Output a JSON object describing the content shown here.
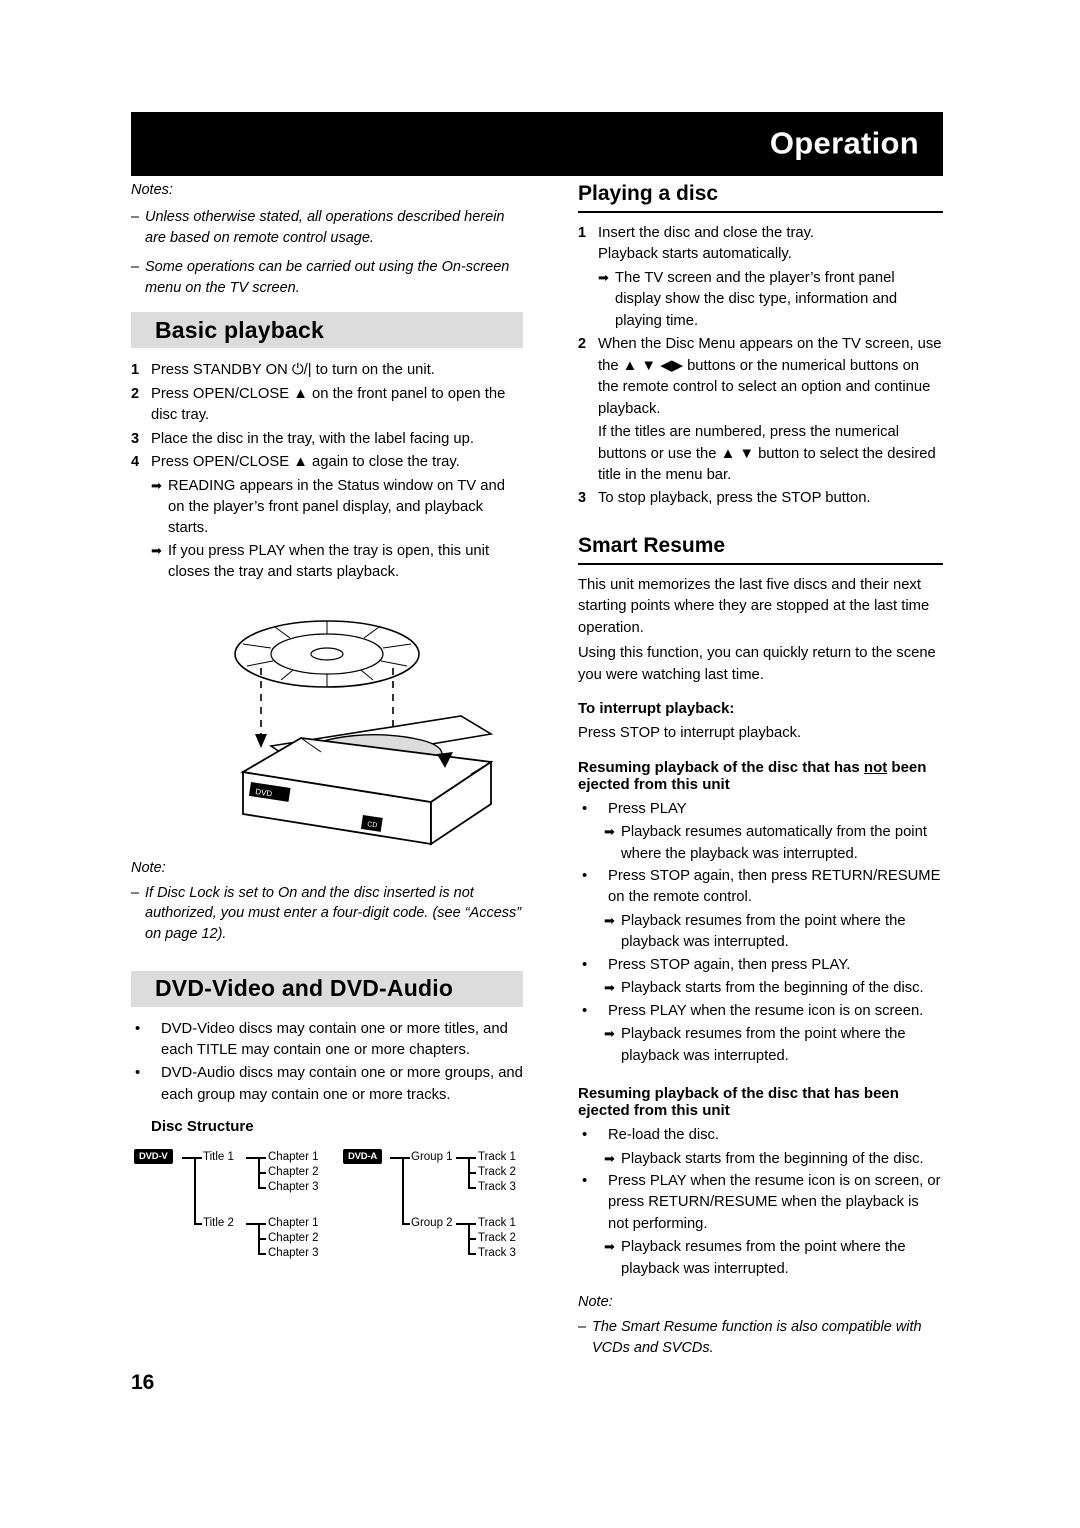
{
  "header": {
    "title": "Operation"
  },
  "page_number": "16",
  "left": {
    "notes_label": "Notes:",
    "notes": [
      "Unless otherwise stated, all operations described herein are based on remote control usage.",
      "Some operations can be carried out using the On-screen menu on the TV screen."
    ],
    "basic_playback": {
      "heading": "Basic playback",
      "steps": [
        {
          "num": "1",
          "text": "Press STANDBY ON ⏻/| to turn on the unit."
        },
        {
          "num": "2",
          "text": "Press OPEN/CLOSE ▲ on the front panel to open the disc tray."
        },
        {
          "num": "3",
          "text": "Place the disc in the tray, with the label facing up."
        },
        {
          "num": "4",
          "text": "Press OPEN/CLOSE ▲ again to close the tray."
        }
      ],
      "arrows": [
        "READING appears in the Status window on TV and on the player’s front panel display, and playback starts.",
        "If you press PLAY when the tray is open, this unit closes the tray and starts playback."
      ]
    },
    "note": {
      "label": "Note:",
      "text": "If Disc Lock is set to On and the disc inserted is not authorized, you must enter a four-digit code. (see “Access” on page 12)."
    },
    "dvd_section": {
      "heading": "DVD-Video and DVD-Audio",
      "bullets": [
        "DVD-Video discs may contain one or more titles, and each TITLE may contain one or more chapters.",
        "DVD-Audio discs may contain one or more groups, and each group may contain one or more tracks."
      ],
      "disc_structure_label": "Disc Structure",
      "diagram": {
        "video_badge": "DVD-V",
        "audio_badge": "DVD-A",
        "video_nodes": [
          {
            "title": "Title 1",
            "children": [
              "Chapter 1",
              "Chapter 2",
              "Chapter 3"
            ]
          },
          {
            "title": "Title 2",
            "children": [
              "Chapter 1",
              "Chapter 2",
              "Chapter 3"
            ]
          }
        ],
        "audio_nodes": [
          {
            "title": "Group 1",
            "children": [
              "Track 1",
              "Track 2",
              "Track 3"
            ]
          },
          {
            "title": "Group 2",
            "children": [
              "Track 1",
              "Track 2",
              "Track 3"
            ]
          }
        ],
        "tray_label": "DVD",
        "disc_center_label": "CD"
      }
    }
  },
  "right": {
    "playing_a_disc": {
      "heading": "Playing a disc",
      "steps": [
        {
          "num": "1",
          "lines": [
            "Insert the disc and close the tray.",
            "Playback starts automatically."
          ],
          "arrows": [
            "The TV screen and the player’s front panel display show the disc type, information and playing time."
          ]
        },
        {
          "num": "2",
          "lines": [
            "When the Disc Menu appears on the TV screen, use the ▲ ▼ ◀▶ buttons or the numerical buttons on the remote control to select an option and continue playback.",
            "If the titles are numbered, press the numerical buttons or use the ▲ ▼ button to select the desired title in the menu bar."
          ],
          "arrows": []
        },
        {
          "num": "3",
          "lines": [
            "To stop playback, press the STOP button."
          ],
          "arrows": []
        }
      ]
    },
    "smart_resume": {
      "heading": "Smart Resume",
      "paragraphs": [
        "This unit memorizes the last five discs and their next starting points where they are stopped at the last time operation.",
        "Using this function, you can quickly return to the scene you were watching last time."
      ],
      "interrupt": {
        "heading": "To interrupt playback:",
        "text": "Press STOP to interrupt playback."
      },
      "not_ejected": {
        "heading_pre": "Resuming playback of the disc that has ",
        "heading_underline": "not",
        "heading_post": " been ejected from this unit",
        "items": [
          {
            "bullet": "Press PLAY",
            "arrows": [
              "Playback resumes automatically from the point where the playback was interrupted."
            ]
          },
          {
            "bullet": "Press STOP again, then press RETURN/RESUME on the remote control.",
            "arrows": [
              "Playback resumes from the point where the playback was interrupted."
            ]
          },
          {
            "bullet": "Press STOP again, then press PLAY.",
            "arrows": [
              "Playback starts from the beginning of the disc."
            ]
          },
          {
            "bullet": "Press PLAY when the resume icon is on screen.",
            "arrows": [
              "Playback resumes from the point where the playback was interrupted."
            ]
          }
        ]
      },
      "ejected": {
        "heading": "Resuming playback of the disc that has been ejected from this unit",
        "items": [
          {
            "bullet": "Re-load the disc.",
            "arrows": [
              "Playback starts from the beginning of the disc."
            ]
          },
          {
            "bullet": "Press PLAY when the resume icon is on screen, or press RETURN/RESUME when the playback is not performing.",
            "arrows": [
              "Playback resumes from the point where the playback was interrupted."
            ]
          }
        ]
      },
      "note": {
        "label": "Note:",
        "text": "The Smart Resume function is also compatible with VCDs and SVCDs."
      }
    }
  }
}
